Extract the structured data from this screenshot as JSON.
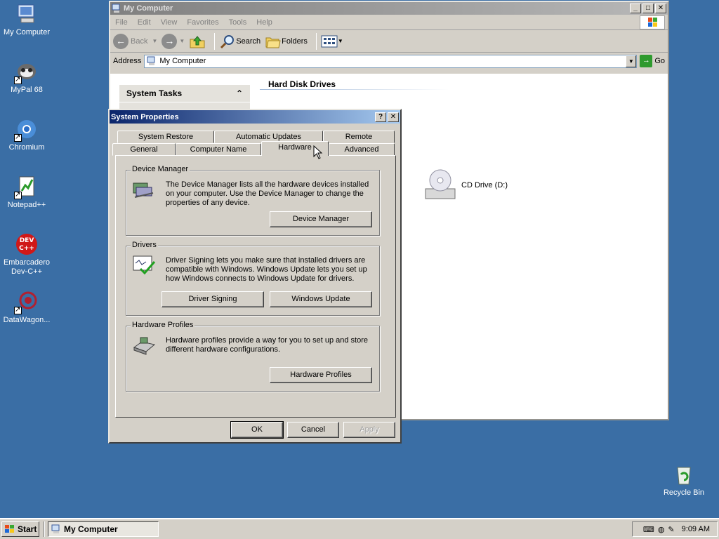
{
  "desktop": {
    "icons": [
      {
        "label": "My Computer",
        "icon": "my-computer-icon"
      },
      {
        "label": "MyPal 68",
        "icon": "mypal-icon"
      },
      {
        "label": "Chromium",
        "icon": "chromium-icon"
      },
      {
        "label": "Notepad++",
        "icon": "notepadpp-icon"
      },
      {
        "label": "Embarcadero Dev-C++",
        "icon": "devcpp-icon"
      },
      {
        "label": "DataWagon...",
        "icon": "datawagon-icon"
      },
      {
        "label": "Recycle Bin",
        "icon": "recycle-bin-icon"
      }
    ]
  },
  "explorer": {
    "title": "My Computer",
    "menu": [
      "File",
      "Edit",
      "View",
      "Favorites",
      "Tools",
      "Help"
    ],
    "toolbar": {
      "back": "Back",
      "search": "Search",
      "folders": "Folders"
    },
    "address_label": "Address",
    "address_value": "My Computer",
    "go_label": "Go",
    "system_tasks": "System Tasks",
    "section_hard_disks": "Hard Disk Drives",
    "cd_drive": "CD Drive (D:)"
  },
  "dialog": {
    "title": "System Properties",
    "tabs_back": [
      "System Restore",
      "Automatic Updates",
      "Remote"
    ],
    "tabs_front": [
      "General",
      "Computer Name",
      "Hardware",
      "Advanced"
    ],
    "selected_tab": "Hardware",
    "device_manager": {
      "legend": "Device Manager",
      "text": "The Device Manager lists all the hardware devices installed on your computer. Use the Device Manager to change the properties of any device.",
      "button": "Device Manager"
    },
    "drivers": {
      "legend": "Drivers",
      "text": "Driver Signing lets you make sure that installed drivers are compatible with Windows. Windows Update lets you set up how Windows connects to Windows Update for drivers.",
      "button_signing": "Driver Signing",
      "button_update": "Windows Update"
    },
    "hardware_profiles": {
      "legend": "Hardware Profiles",
      "text": "Hardware profiles provide a way for you to set up and store different hardware configurations.",
      "button": "Hardware Profiles"
    },
    "ok": "OK",
    "cancel": "Cancel",
    "apply": "Apply"
  },
  "taskbar": {
    "start": "Start",
    "task": "My Computer",
    "clock": "9:09 AM"
  }
}
